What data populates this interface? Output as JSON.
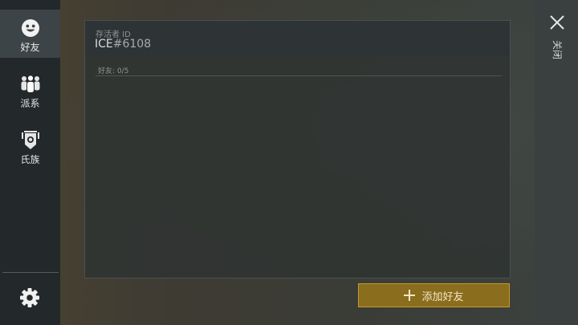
{
  "sidebar": {
    "items": [
      {
        "label": "好友",
        "icon": "smiley-face-icon",
        "active": true
      },
      {
        "label": "派系",
        "icon": "group-people-icon",
        "active": false
      },
      {
        "label": "氏族",
        "icon": "clan-banner-icon",
        "active": false
      }
    ],
    "settings_icon": "gear-icon"
  },
  "panel": {
    "id_label": "存活者 ID",
    "id_prefix": "ICE",
    "id_number": "#6108",
    "friends_count": "好友: 0/5"
  },
  "add_friend_button": {
    "label": "添加好友",
    "icon": "plus-icon"
  },
  "close": {
    "label": "关闭",
    "icon": "close-icon"
  },
  "colors": {
    "accent_gold": "#c49b2c",
    "button_fill": "#8a6d1d",
    "sidebar": "#23282a",
    "sidebar_active": "#3d4447"
  }
}
